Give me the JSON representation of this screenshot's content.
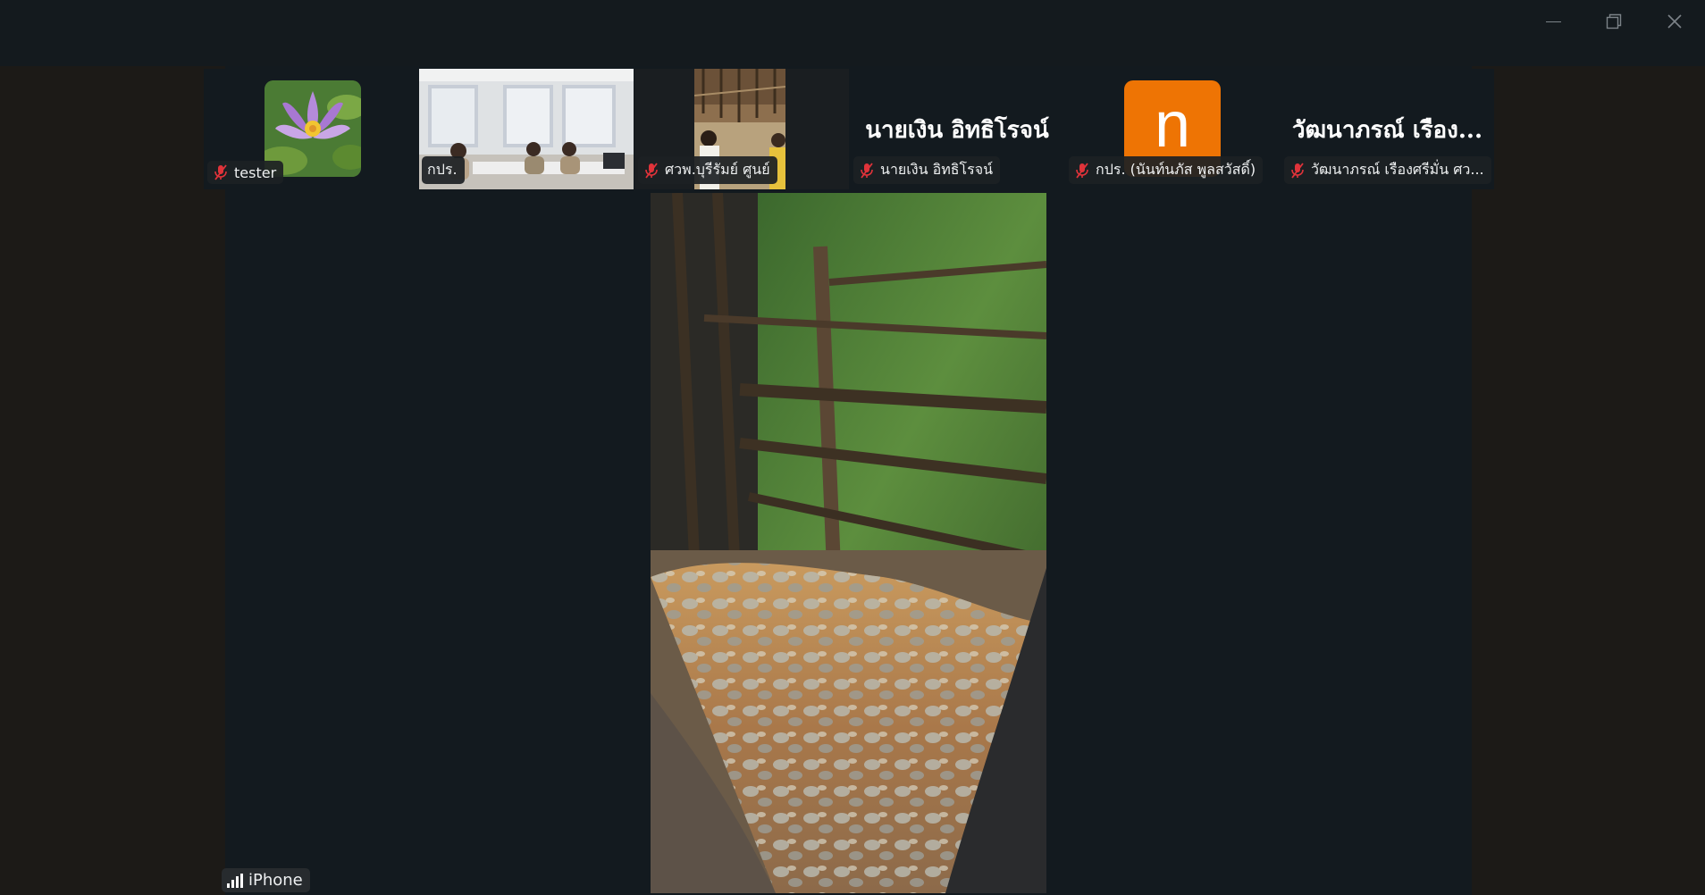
{
  "window": {
    "controls": {
      "minimize": "minimize",
      "restore": "restore",
      "close": "close"
    }
  },
  "participants": [
    {
      "name": "tester",
      "muted": true
    },
    {
      "name": "กปร.",
      "muted": false
    },
    {
      "name": "ศวพ.บุรีรัมย์ ศูนย์",
      "muted": true
    },
    {
      "name": "นายเงิน อิทธิโรจน์",
      "display_name": "นายเงิน  อิทธิโรจน์",
      "muted": true
    },
    {
      "name": "กปร. (นันท์นภัส พูลสวัสดิ์)",
      "avatar_letter": "n",
      "muted": true
    },
    {
      "name": "วัฒนาภรณ์ เรืองศรีมั่น ศว...",
      "display_name": "วัฒนาภรณ์  เรือง...",
      "muted": true
    }
  ],
  "main": {
    "device_label": "iPhone"
  },
  "colors": {
    "avatar_orange": "#ee7404",
    "muted_red": "#e0333a",
    "stage_bg": "#131a1f"
  }
}
